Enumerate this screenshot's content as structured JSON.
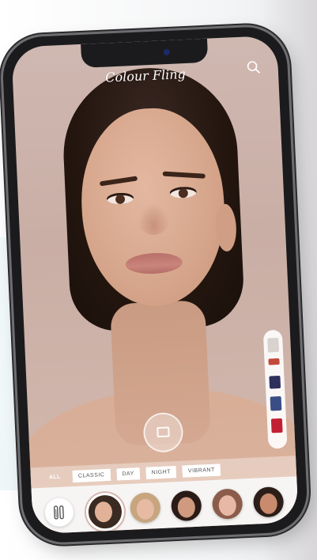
{
  "app": {
    "title": "Colour Fling"
  },
  "header": {
    "search_icon": "search-icon"
  },
  "categories": {
    "items": [
      "ALL",
      "CLASSIC",
      "DAY",
      "NIGHT",
      "VIBRANT"
    ],
    "selected": "ALL"
  },
  "shade_palette": {
    "colors": [
      "#d9d2cf",
      "#c24a3a",
      "#2d2f5c",
      "#3b4d86",
      "#c21f33"
    ]
  },
  "bottom_bar": {
    "left_icon": "brushes-icon",
    "looks": [
      {
        "name": "look-1",
        "hair": "#3a2a22",
        "skin": "#e2b298"
      },
      {
        "name": "look-2",
        "hair": "#c7a57f",
        "skin": "#e7bba3"
      },
      {
        "name": "look-3",
        "hair": "#2a1b16",
        "skin": "#cf9a7f"
      },
      {
        "name": "look-4",
        "hair": "#8b5c4a",
        "skin": "#e8b7a6"
      },
      {
        "name": "look-5",
        "hair": "#2b1e19",
        "skin": "#c98a6d"
      }
    ]
  }
}
